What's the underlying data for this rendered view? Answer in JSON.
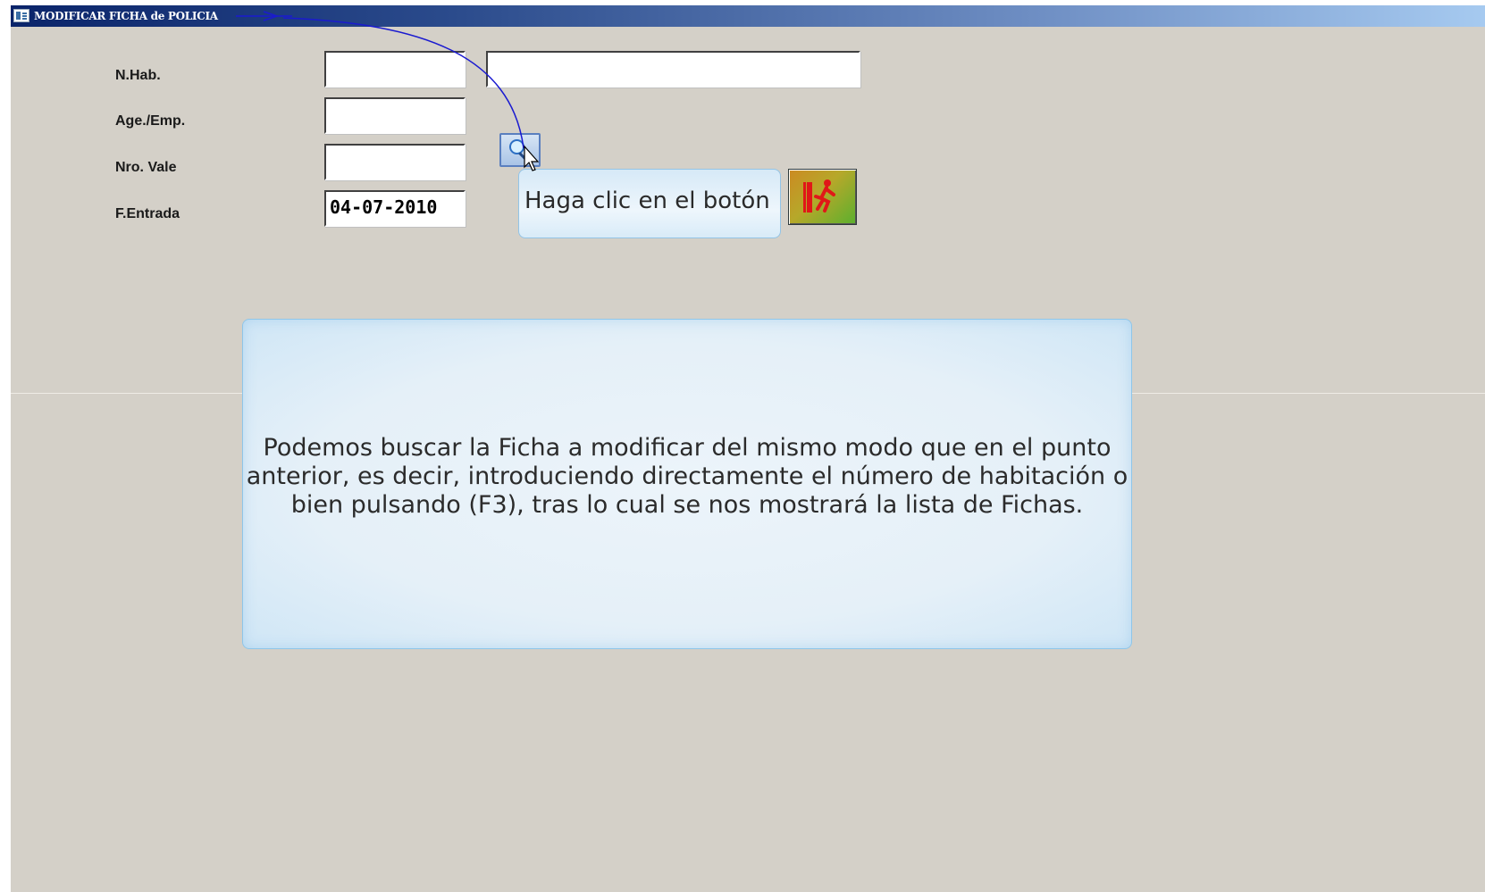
{
  "window": {
    "title": "MODIFICAR FICHA de POLICIA"
  },
  "form": {
    "labels": {
      "room": "N.Hab.",
      "agency": "Age./Emp.",
      "voucher": "Nro. Vale",
      "entry_date": "F.Entrada"
    },
    "values": {
      "room": "",
      "room_name": "",
      "agency": "",
      "voucher": "",
      "entry_date": "04-07-2010"
    }
  },
  "tutorial": {
    "callout": "Haga clic en el botón",
    "info_lines": [
      "Podemos buscar la Ficha a modificar del mismo modo que en el punto",
      "anterior, es decir, introduciendo directamente el número de habitación o",
      "bien pulsando  (F3), tras lo cual se nos mostrará la lista de Fichas."
    ]
  },
  "icons": {
    "window": "window-icon",
    "search": "magnifier-icon",
    "exit": "exit-door-icon",
    "cursor": "mouse-pointer-icon"
  },
  "colors": {
    "window_bg": "#d4d0c8",
    "titlebar_start": "#0a246a",
    "titlebar_end": "#a6caf0",
    "pointer_line": "#1a1ad0",
    "panel_border": "#8ec6ea"
  }
}
